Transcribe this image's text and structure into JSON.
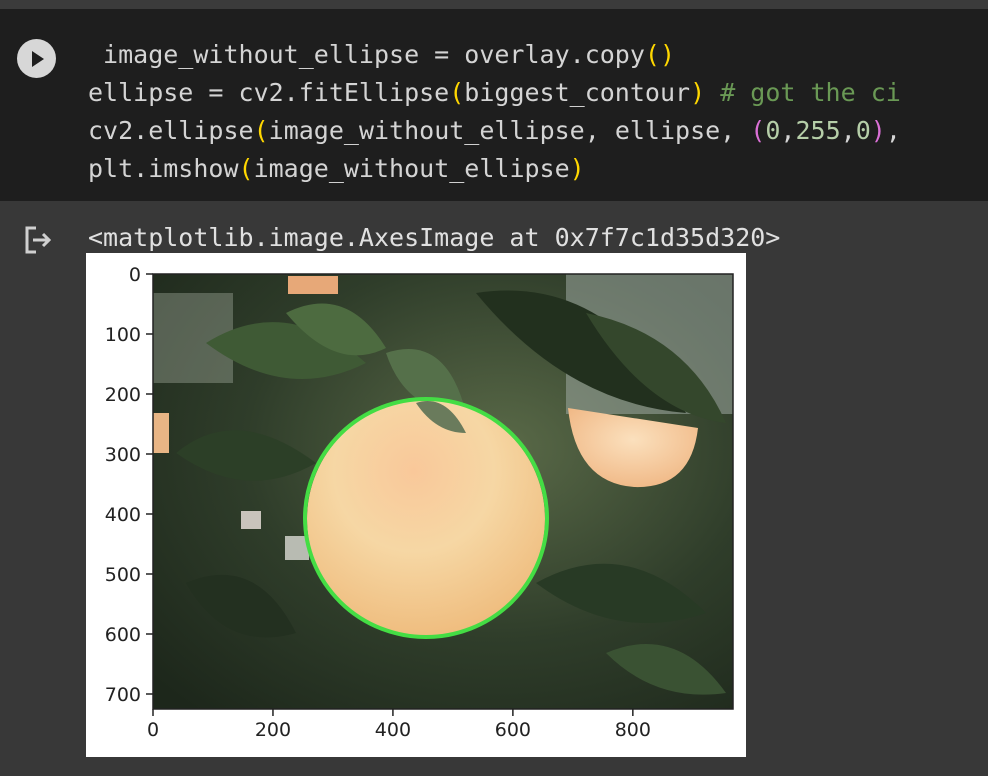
{
  "code_cell": {
    "lines": [
      {
        "parts": [
          {
            "t": " image_without_ellipse = overlay.copy",
            "c": ""
          },
          {
            "t": "()",
            "c": "tok-paren"
          }
        ]
      },
      {
        "parts": [
          {
            "t": "ellipse = cv2.fitEllipse",
            "c": ""
          },
          {
            "t": "(",
            "c": "tok-paren"
          },
          {
            "t": "biggest_contour",
            "c": ""
          },
          {
            "t": ")",
            "c": "tok-paren"
          },
          {
            "t": " ",
            "c": ""
          },
          {
            "t": "# got the ci",
            "c": "tok-comment"
          }
        ]
      },
      {
        "parts": [
          {
            "t": "cv2.ellipse",
            "c": ""
          },
          {
            "t": "(",
            "c": "tok-paren"
          },
          {
            "t": "image_without_ellipse, ellipse, ",
            "c": ""
          },
          {
            "t": "(",
            "c": "tok-paren2"
          },
          {
            "t": "0",
            "c": "tok-num"
          },
          {
            "t": ",",
            "c": ""
          },
          {
            "t": "255",
            "c": "tok-num"
          },
          {
            "t": ",",
            "c": ""
          },
          {
            "t": "0",
            "c": "tok-num"
          },
          {
            "t": ")",
            "c": "tok-paren2"
          },
          {
            "t": ",",
            "c": ""
          }
        ]
      },
      {
        "parts": [
          {
            "t": "plt.imshow",
            "c": ""
          },
          {
            "t": "(",
            "c": "tok-paren"
          },
          {
            "t": "image_without_ellipse",
            "c": ""
          },
          {
            "t": ")",
            "c": "tok-paren"
          }
        ]
      }
    ],
    "run_icon": "play-icon"
  },
  "output": {
    "icon": "output-redirect-icon",
    "repr_text": "<matplotlib.image.AxesImage at 0x7f7c1d35d320>",
    "plot": {
      "x_ticks": [
        "0",
        "200",
        "400",
        "600",
        "800"
      ],
      "y_ticks": [
        "0",
        "100",
        "200",
        "300",
        "400",
        "500",
        "600",
        "700"
      ],
      "ellipse_color": "#44dd44"
    }
  }
}
